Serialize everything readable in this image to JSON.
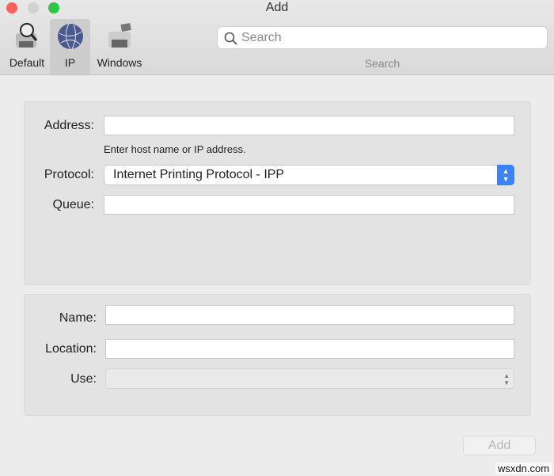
{
  "window": {
    "title": "Add"
  },
  "toolbar": {
    "items": [
      {
        "label": "Default",
        "icon": "default-printer-icon"
      },
      {
        "label": "IP",
        "icon": "globe-icon",
        "selected": true
      },
      {
        "label": "Windows",
        "icon": "windows-printer-icon"
      }
    ],
    "search": {
      "placeholder": "Search",
      "label": "Search"
    }
  },
  "form": {
    "address_label": "Address:",
    "address_value": "",
    "address_hint": "Enter host name or IP address.",
    "protocol_label": "Protocol:",
    "protocol_value": "Internet Printing Protocol - IPP",
    "queue_label": "Queue:",
    "queue_value": "",
    "name_label": "Name:",
    "name_value": "",
    "location_label": "Location:",
    "location_value": "",
    "use_label": "Use:",
    "use_value": ""
  },
  "footer": {
    "add_label": "Add"
  },
  "watermark": "wsxdn.com",
  "colors": {
    "close": "#fe5f57",
    "minimize": "#d0d0d0",
    "zoom": "#28c840",
    "accent": "#3b82f6"
  }
}
